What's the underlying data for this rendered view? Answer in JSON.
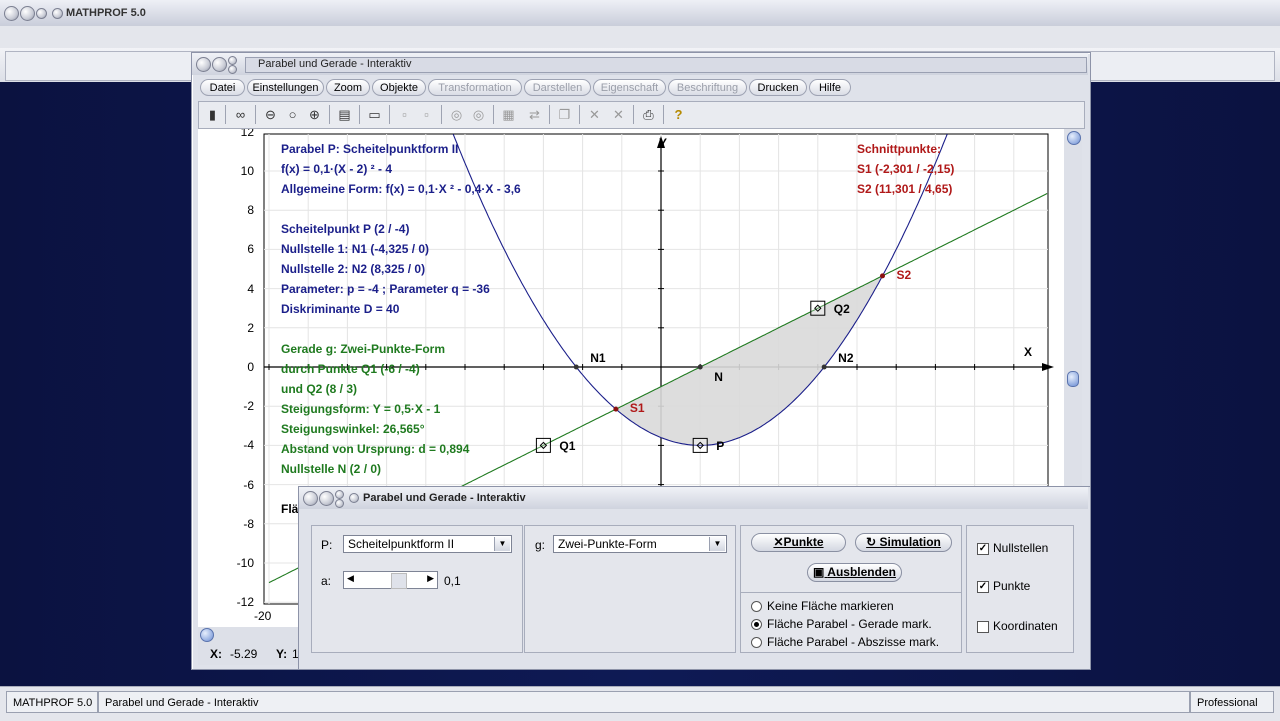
{
  "app": {
    "title": "MATHPROF 5.0"
  },
  "main_window": {
    "title": "Parabel und Gerade - Interaktiv"
  },
  "menu": [
    {
      "label": "Datei",
      "enabled": true
    },
    {
      "label": "Einstellungen",
      "enabled": true
    },
    {
      "label": "Zoom",
      "enabled": true
    },
    {
      "label": "Objekte",
      "enabled": true
    },
    {
      "label": "Transformation",
      "enabled": false
    },
    {
      "label": "Darstellen",
      "enabled": false
    },
    {
      "label": "Eigenschaft",
      "enabled": false
    },
    {
      "label": "Beschriftung",
      "enabled": false
    },
    {
      "label": "Drucken",
      "enabled": true
    },
    {
      "label": "Hilfe",
      "enabled": true
    }
  ],
  "toolbar_icons": [
    "calculator-icon",
    "glasses-icon",
    "zoom-out-icon",
    "zoom-reset-icon",
    "zoom-in-icon",
    "properties-icon",
    "window-icon",
    "box1-icon",
    "box2-icon",
    "circle1-icon",
    "circle2-icon",
    "table-icon",
    "swap-icon",
    "copy-icon",
    "cross1-icon",
    "cross2-icon",
    "print-icon",
    "help-icon"
  ],
  "plot": {
    "y_ticks": [
      "12",
      "10",
      "8",
      "6",
      "4",
      "2",
      "0",
      "-2",
      "-4",
      "-6",
      "-8",
      "-10",
      "-12"
    ],
    "x_tick_left": "-20",
    "axis_x_label": "X",
    "axis_y_label": "Y",
    "info_blue": [
      "Parabel P: Scheitelpunktform II",
      "f(x) = 0,1·(X - 2) ² - 4",
      "Allgemeine Form: f(x) = 0,1·X ² - 0,4·X - 3,6",
      "",
      "Scheitelpunkt P (2 / -4)",
      "Nullstelle 1: N1 (-4,325 / 0)",
      "Nullstelle 2: N2 (8,325 / 0)",
      "Parameter: p = -4 ; Parameter q = -36",
      "Diskriminante D = 40"
    ],
    "info_green": [
      "Gerade g: Zwei-Punkte-Form",
      "durch Punkte Q1 (-6 / -4)",
      "und Q2 (8 / 3)",
      "Steigungsform: Y = 0,5·X - 1",
      "Steigungswinkel: 26,565°",
      "Abstand von Ursprung: d = 0,894",
      "Nullstelle N (2 / 0)"
    ],
    "info_red": [
      "Schnittpunkte:",
      "S1 (-2,301 / -2,15)",
      "S2 (11,301 / 4,65)"
    ],
    "partial_label": "Flä",
    "point_labels": {
      "N1": "N1",
      "N2": "N2",
      "N": "N",
      "S1": "S1",
      "S2": "S2",
      "Q1": "Q1",
      "Q2": "Q2",
      "P": "P"
    },
    "coords": {
      "x_label": "X:",
      "x_value": "-5.29",
      "y_label": "Y:",
      "y_value": "1"
    }
  },
  "chart_data": {
    "type": "line",
    "xlim": [
      -20,
      30
    ],
    "ylim": [
      -12,
      12
    ],
    "grid": true,
    "series": [
      {
        "name": "P",
        "formula": "0.1*(x-2)^2-4",
        "color": "#1b1f8a"
      },
      {
        "name": "g",
        "formula": "0.5*x-1",
        "color": "#1f7a1f"
      }
    ],
    "points": [
      {
        "label": "N1",
        "x": -4.325,
        "y": 0
      },
      {
        "label": "N2",
        "x": 8.325,
        "y": 0
      },
      {
        "label": "N",
        "x": 2,
        "y": 0
      },
      {
        "label": "S1",
        "x": -2.301,
        "y": -2.15
      },
      {
        "label": "S2",
        "x": 11.301,
        "y": 4.65
      },
      {
        "label": "Q1",
        "x": -6,
        "y": -4
      },
      {
        "label": "Q2",
        "x": 8,
        "y": 3
      },
      {
        "label": "P",
        "x": 2,
        "y": -4
      }
    ]
  },
  "dialog": {
    "title": "Parabel und Gerade - Interaktiv",
    "p_label": "P:",
    "p_value": "Scheitelpunktform II",
    "a_label": "a:",
    "a_value": "0,1",
    "a_slider": 0.55,
    "g_label": "g:",
    "g_value": "Zwei-Punkte-Form",
    "btn_points": "Punkte",
    "btn_simulation": "Simulation",
    "btn_hide": "Ausblenden",
    "radios": [
      {
        "label": "Keine Fläche markieren",
        "selected": false
      },
      {
        "label": "Fläche Parabel - Gerade mark.",
        "selected": true
      },
      {
        "label": "Fläche Parabel - Abszisse mark.",
        "selected": false
      }
    ],
    "checks": [
      {
        "label": "Nullstellen",
        "checked": true
      },
      {
        "label": "Punkte",
        "checked": true
      },
      {
        "label": "Koordinaten",
        "checked": false
      }
    ]
  },
  "statusbar": {
    "app": "MATHPROF 5.0",
    "window": "Parabel und Gerade - Interaktiv",
    "edition": "Professional"
  }
}
